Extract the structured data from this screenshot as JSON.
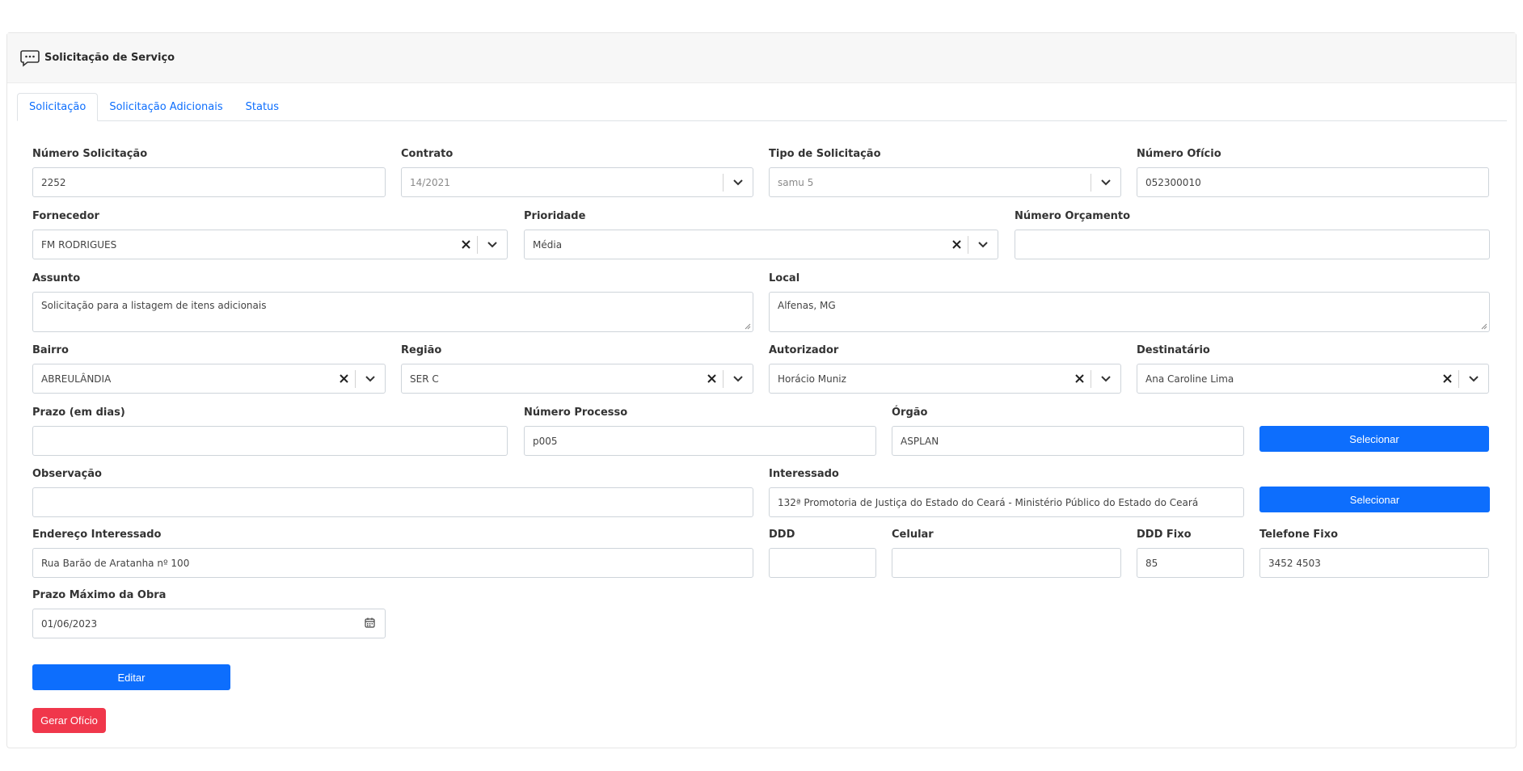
{
  "header": {
    "title": "Solicitação de Serviço",
    "icon": "chat-dots-icon"
  },
  "tabs": [
    {
      "label": "Solicitação",
      "active": true
    },
    {
      "label": "Solicitação Adicionais",
      "active": false
    },
    {
      "label": "Status",
      "active": false
    }
  ],
  "form": {
    "numero_solicitacao": {
      "label": "Número Solicitação",
      "value": "2252"
    },
    "contrato": {
      "label": "Contrato",
      "value": "14/2021"
    },
    "tipo_solicitacao": {
      "label": "Tipo de Solicitação",
      "value": "samu 5"
    },
    "numero_oficio": {
      "label": "Número Ofício",
      "value": "052300010"
    },
    "fornecedor": {
      "label": "Fornecedor",
      "value": "FM RODRIGUES"
    },
    "prioridade": {
      "label": "Prioridade",
      "value": "Média"
    },
    "numero_orcamento": {
      "label": "Número Orçamento",
      "value": ""
    },
    "assunto": {
      "label": "Assunto",
      "value": "Solicitação para a listagem de itens adicionais"
    },
    "local": {
      "label": "Local",
      "value": "Alfenas, MG"
    },
    "bairro": {
      "label": "Bairro",
      "value": "ABREULÂNDIA"
    },
    "regiao": {
      "label": "Região",
      "value": "SER C"
    },
    "autorizador": {
      "label": "Autorizador",
      "value": "Horácio Muniz"
    },
    "destinatario": {
      "label": "Destinatário",
      "value": "Ana Caroline Lima"
    },
    "prazo_dias": {
      "label": "Prazo (em dias)",
      "value": ""
    },
    "numero_processo": {
      "label": "Número Processo",
      "value": "p005"
    },
    "orgao": {
      "label": "Órgão",
      "value": "ASPLAN"
    },
    "observacao": {
      "label": "Observação",
      "value": ""
    },
    "interessado": {
      "label": "Interessado",
      "value": "132ª Promotoria de Justiça do Estado do Ceará - Ministério Público do Estado do Ceará"
    },
    "endereco_interessado": {
      "label": "Endereço Interessado",
      "value": "Rua Barão de Aratanha nº 100"
    },
    "ddd": {
      "label": "DDD",
      "value": ""
    },
    "celular": {
      "label": "Celular",
      "value": ""
    },
    "ddd_fixo": {
      "label": "DDD Fixo",
      "value": "85"
    },
    "telefone_fixo": {
      "label": "Telefone Fixo",
      "value": "3452 4503"
    },
    "prazo_maximo_obra": {
      "label": "Prazo Máximo da Obra",
      "value": "01/06/2023"
    }
  },
  "buttons": {
    "selecionar_orgao": "Selecionar",
    "selecionar_interessado": "Selecionar",
    "editar": "Editar",
    "gerar_oficio": "Gerar Ofício"
  },
  "colors": {
    "primary": "#0d6efd",
    "danger": "#f0374b"
  }
}
